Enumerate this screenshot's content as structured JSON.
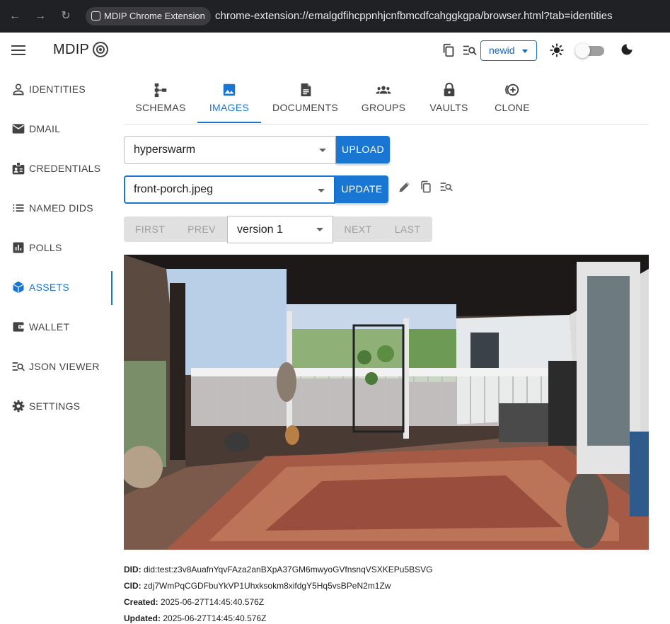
{
  "browser": {
    "extension_name": "MDIP Chrome Extension",
    "url": "chrome-extension://emalgdfihcppnhjcnfbmcdfcahggkgpa/browser.html?tab=identities"
  },
  "header": {
    "brand": "MDIP",
    "identity_select_value": "newid"
  },
  "sidebar": {
    "items": [
      {
        "label": "IDENTITIES",
        "icon": "person-icon"
      },
      {
        "label": "DMAIL",
        "icon": "mail-icon"
      },
      {
        "label": "CREDENTIALS",
        "icon": "badge-icon"
      },
      {
        "label": "NAMED DIDS",
        "icon": "list-icon"
      },
      {
        "label": "POLLS",
        "icon": "poll-icon"
      },
      {
        "label": "ASSETS",
        "icon": "cube-icon"
      },
      {
        "label": "WALLET",
        "icon": "wallet-icon"
      },
      {
        "label": "JSON VIEWER",
        "icon": "json-search-icon"
      },
      {
        "label": "SETTINGS",
        "icon": "gear-icon"
      }
    ],
    "active": "ASSETS"
  },
  "tabs": {
    "items": [
      {
        "label": "SCHEMAS",
        "icon": "schema-icon"
      },
      {
        "label": "IMAGES",
        "icon": "image-icon"
      },
      {
        "label": "DOCUMENTS",
        "icon": "document-icon"
      },
      {
        "label": "GROUPS",
        "icon": "groups-icon"
      },
      {
        "label": "VAULTS",
        "icon": "lock-icon"
      },
      {
        "label": "CLONE",
        "icon": "add-circle-icon"
      }
    ],
    "active": "IMAGES"
  },
  "controls": {
    "registry_value": "hyperswarm",
    "upload_label": "UPLOAD",
    "image_value": "front-porch.jpeg",
    "update_label": "UPDATE",
    "first_label": "FIRST",
    "prev_label": "PREV",
    "version_value": "version 1",
    "next_label": "NEXT",
    "last_label": "LAST"
  },
  "meta": {
    "did_label": "DID:",
    "did_value": "did:test:z3v8AuafnYqvFAza2anBXpA37GM6mwyoGVfnsnqVSXKEPu5BSVG",
    "cid_label": "CID:",
    "cid_value": "zdj7WmPqCGDFbuYkVP1Uhxksokm8xifdgY5Hq5vsBPeN2m1Zw",
    "created_label": "Created:",
    "created_value": "2025-06-27T14:45:40.576Z",
    "updated_label": "Updated:",
    "updated_value": "2025-06-27T14:45:40.576Z"
  },
  "colors": {
    "accent": "#1976d2",
    "chrome_bg": "#202124"
  }
}
